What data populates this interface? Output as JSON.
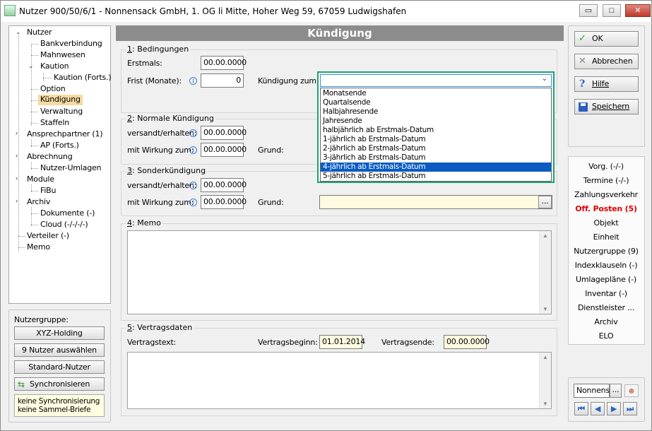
{
  "window": {
    "title": "Nutzer 900/50/6/1 - Nonnensack GmbH, 1. OG li Mitte, Hoher Weg 59, 67059 Ludwigshafen",
    "min": "▭",
    "max": "□",
    "close": "✕"
  },
  "tree": {
    "items": [
      {
        "label": "Nutzer"
      },
      {
        "label": "Bankverbindung"
      },
      {
        "label": "Mahnwesen"
      },
      {
        "label": "Kaution"
      },
      {
        "label": "Kaution (Forts.)"
      },
      {
        "label": "Option"
      },
      {
        "label": "Kündigung"
      },
      {
        "label": "Verwaltung"
      },
      {
        "label": "Staffeln"
      },
      {
        "label": "Ansprechpartner (1)"
      },
      {
        "label": "AP (Forts.)"
      },
      {
        "label": "Abrechnung"
      },
      {
        "label": "Nutzer-Umlagen"
      },
      {
        "label": "Module"
      },
      {
        "label": "FiBu"
      },
      {
        "label": "Archiv"
      },
      {
        "label": "Dokumente (-)"
      },
      {
        "label": "Cloud (-/-/-/-)"
      },
      {
        "label": "Verteiler (-)"
      },
      {
        "label": "Memo"
      }
    ]
  },
  "nutzergruppe": {
    "label": "Nutzergruppe:",
    "group_button": "XYZ-Holding",
    "select_button": "9 Nutzer auswählen",
    "standard_button": "Standard-Nutzer",
    "sync_button": "Synchronisieren",
    "note_line1": "keine Synchronisierung",
    "note_line2": "keine Sammel-Briefe"
  },
  "main": {
    "header": "Kündigung",
    "bedingungen": {
      "title_num": "1",
      "title": ": Bedingungen",
      "erstmals_label": "Erstmals:",
      "erstmals_value": "00.00.0000",
      "frist_label": "Frist (Monate):",
      "frist_value": "0",
      "kuendigung_zum_label": "Kündigung zum:",
      "kuendigung_zum_value": ""
    },
    "normale": {
      "title_num": "2",
      "title": ": Normale Kündigung",
      "versandt_label": "versandt/erhalten:",
      "versandt_value": "00.00.0000",
      "wirkung_label": "mit Wirkung zum:",
      "wirkung_value": "00.00.0000",
      "grund_label": "Grund:"
    },
    "sonder": {
      "title_num": "3",
      "title": ": Sonderkündigung",
      "versandt_label": "versandt/erhalten:",
      "versandt_value": "00.00.0000",
      "wirkung_label": "mit Wirkung zum:",
      "wirkung_value": "00.00.0000",
      "grund_label": "Grund:",
      "grund_value": "",
      "grund_button": "..."
    },
    "memo": {
      "title_num": "4",
      "title": ": Memo"
    },
    "vertragsdaten": {
      "title_num": "5",
      "title": ": Vertragsdaten",
      "vertragstext_label": "Vertragstext:",
      "beginn_label": "Vertragsbeginn:",
      "beginn_value": "01.01.2014",
      "ende_label": "Vertragsende:",
      "ende_value": "00.00.0000"
    }
  },
  "dropdown": {
    "options": [
      {
        "label": "Monatsende"
      },
      {
        "label": "Quartalsende"
      },
      {
        "label": "Halbjahresende"
      },
      {
        "label": "Jahresende"
      },
      {
        "label": "halbjährlich ab Erstmals-Datum"
      },
      {
        "label": "1-jährlich ab Erstmals-Datum"
      },
      {
        "label": "2-jährlich ab Erstmals-Datum"
      },
      {
        "label": "3-jährlich ab Erstmals-Datum"
      },
      {
        "label": "4-jährlich ab Erstmals-Datum"
      },
      {
        "label": "5-jährlich ab Erstmals-Datum"
      }
    ],
    "highlighted_index": 8
  },
  "actions": {
    "ok": "OK",
    "abbrechen": "Abbrechen",
    "hilfe": "Hilfe",
    "speichern": "Speichern"
  },
  "side_links": [
    {
      "label": "Vorg. (-/-)"
    },
    {
      "label": "Termine (-/-)"
    },
    {
      "label": "Zahlungsverkehr"
    },
    {
      "label": "Off. Posten (5)",
      "color": "#e00000"
    },
    {
      "label": "Objekt"
    },
    {
      "label": "Einheit"
    },
    {
      "label": "Nutzergruppe (9)"
    },
    {
      "label": "Indexklauseln (-)"
    },
    {
      "label": "Umlagepläne (-)"
    },
    {
      "label": "Inventar (-)"
    },
    {
      "label": "Dienstleister ..."
    },
    {
      "label": "Archiv"
    },
    {
      "label": "ELO"
    }
  ],
  "navigator": {
    "search_value": "Nonnens",
    "search_button": "..."
  },
  "colors": {
    "header_bg": "#8c8c8c",
    "dropdown_focus": "#1aa37a",
    "highlight": "#0a5cc2",
    "tree_selected": "#f6d9a0",
    "warning_red": "#e00000"
  }
}
